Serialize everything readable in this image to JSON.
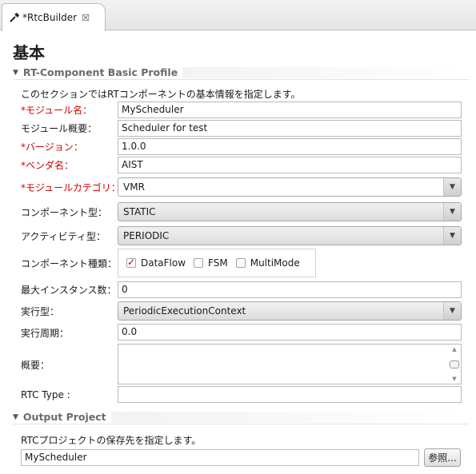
{
  "tab": {
    "title": "*RtcBuilder",
    "close_glyph": "☒"
  },
  "page_title": "基本",
  "basic_section": {
    "header": "RT-Component Basic Profile",
    "description": "このセクションではRTコンポーネントの基本情報を指定します。",
    "module_name": {
      "label": "*モジュール名：",
      "value": "MyScheduler"
    },
    "module_description": {
      "label": "モジュール概要：",
      "value": "Scheduler for test"
    },
    "version": {
      "label": "*バージョン：",
      "value": "1.0.0"
    },
    "vendor": {
      "label": "*ベンダ名：",
      "value": "AIST"
    },
    "category": {
      "label": "*モジュールカテゴリ：",
      "value": "VMR"
    },
    "component_type": {
      "label": "コンポーネント型：",
      "value": "STATIC"
    },
    "activity_type": {
      "label": "アクティビティ型：",
      "value": "PERIODIC"
    },
    "component_kind": {
      "label": "コンポーネント種類：",
      "options": [
        {
          "label": "DataFlow",
          "checked": true
        },
        {
          "label": "FSM",
          "checked": false
        },
        {
          "label": "MultiMode",
          "checked": false
        }
      ]
    },
    "max_instances": {
      "label": "最大インスタンス数：",
      "value": "0"
    },
    "execution_type": {
      "label": "実行型：",
      "value": "PeriodicExecutionContext"
    },
    "execution_rate": {
      "label": "実行周期：",
      "value": "0.0"
    },
    "abstract": {
      "label": "概要：",
      "value": ""
    },
    "rtc_type": {
      "label": "RTC Type :",
      "value": ""
    }
  },
  "output_section": {
    "header": "Output Project",
    "description": "RTCプロジェクトの保存先を指定します。",
    "project": {
      "value": "MyScheduler"
    },
    "browse_label": "参照..."
  },
  "colors": {
    "required_label": "#d40000",
    "section_header": "#6b6b6b"
  },
  "icons": {
    "tab_icon": "hammer-icon",
    "collapse": "triangle-down-icon",
    "dropdown": "triangle-down-icon"
  }
}
